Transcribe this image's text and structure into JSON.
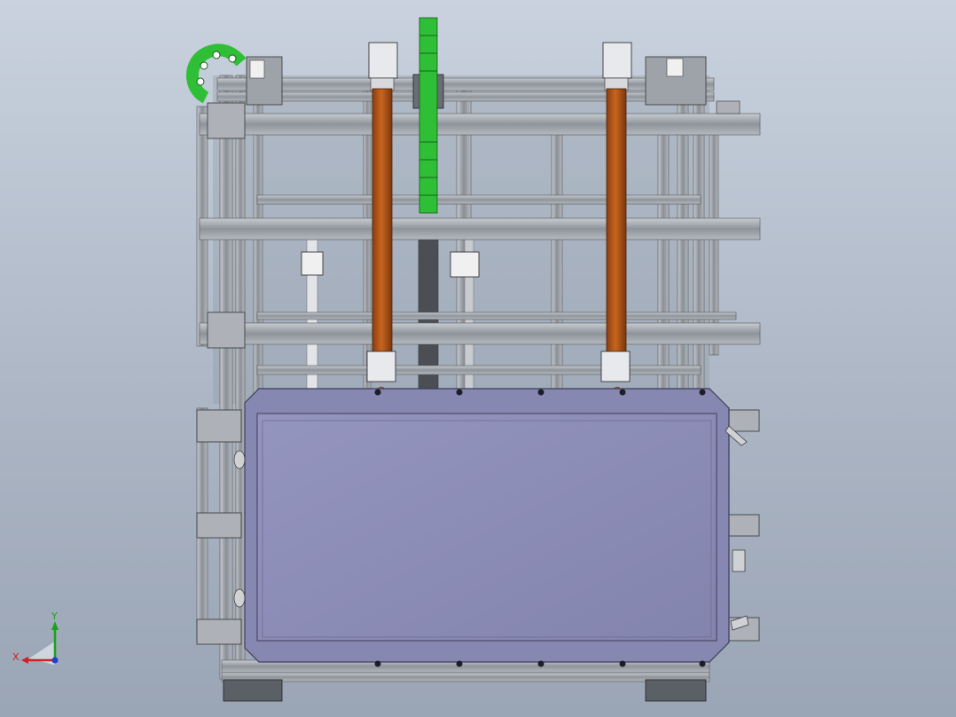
{
  "app": {
    "view": "cad-3d-viewport"
  },
  "triad": {
    "x_label": "X",
    "y_label": "Y",
    "x_color": "#d21f1f",
    "y_color": "#1aa31a",
    "z_color": "#1f3fd2"
  },
  "colors": {
    "background_top": "#c9d2de",
    "background_bottom": "#9aa5b5",
    "frame": "#9aa0a8",
    "frame_dark": "#5a5f66",
    "rail_copper": "#b5561a",
    "cable_chain": "#29b42f",
    "plate": "#8e8fb8",
    "plate_border": "#6f6f9a"
  }
}
